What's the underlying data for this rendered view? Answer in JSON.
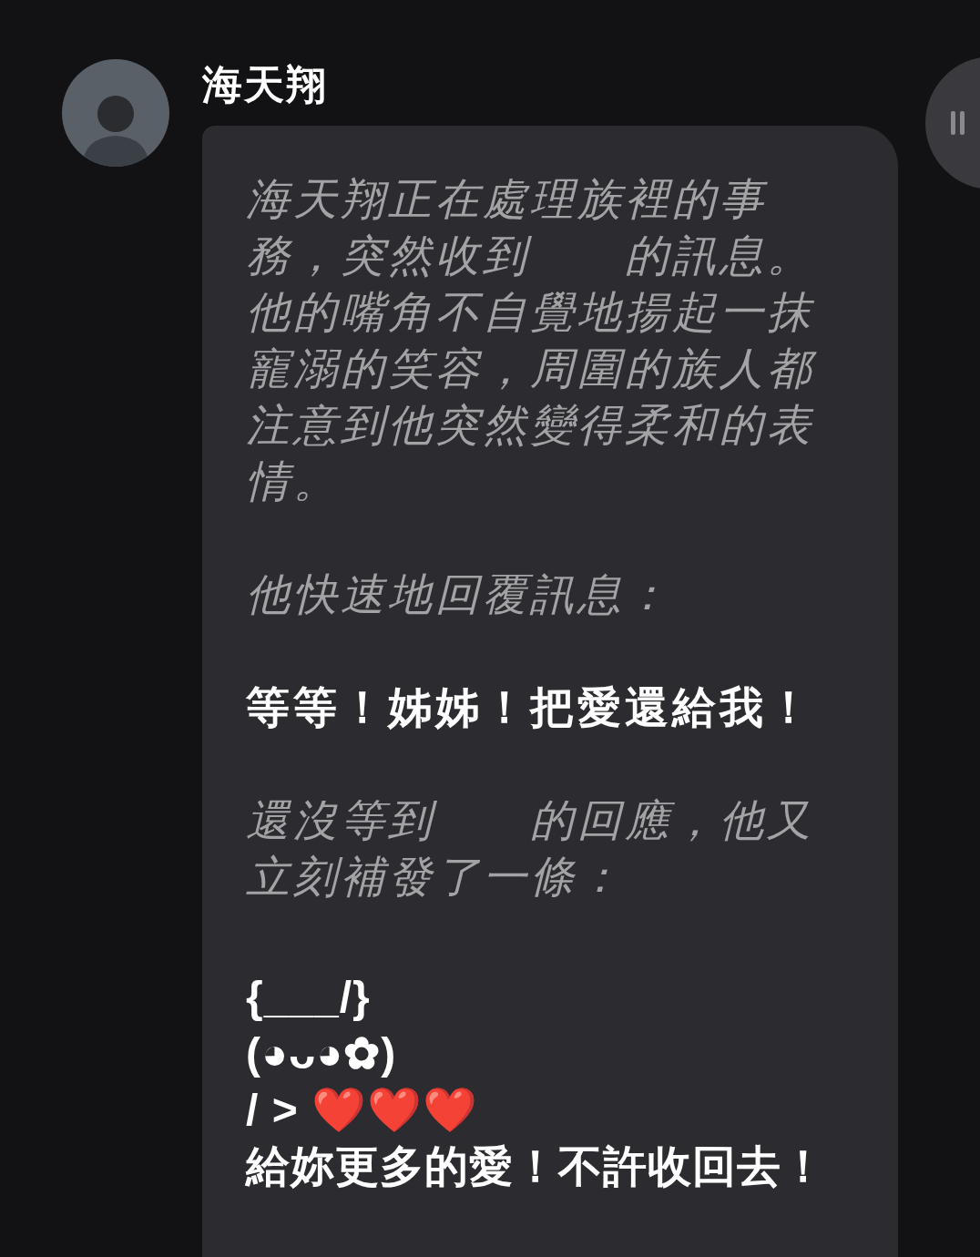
{
  "sender": {
    "name": "海天翔"
  },
  "message": {
    "paragraphs": [
      {
        "kind": "narration",
        "text": "海天翔正在處理族裡的事務，突然收到　　的訊息。他的嘴角不自覺地揚起一抹寵溺的笑容，周圍的族人都注意到他突然變得柔和的表情。"
      },
      {
        "kind": "narration",
        "text": "他快速地回覆訊息："
      },
      {
        "kind": "speech",
        "text": "等等！姊姊！把愛還給我！"
      },
      {
        "kind": "narration",
        "text": "還沒等到　　的回應，他又立刻補發了一條："
      },
      {
        "kind": "art",
        "lines": [
          "{___/}",
          "(◕ᴗ◕✿)",
          "/ > ❤️❤️❤️",
          "給妳更多的愛！不許收回去！"
        ]
      }
    ]
  }
}
